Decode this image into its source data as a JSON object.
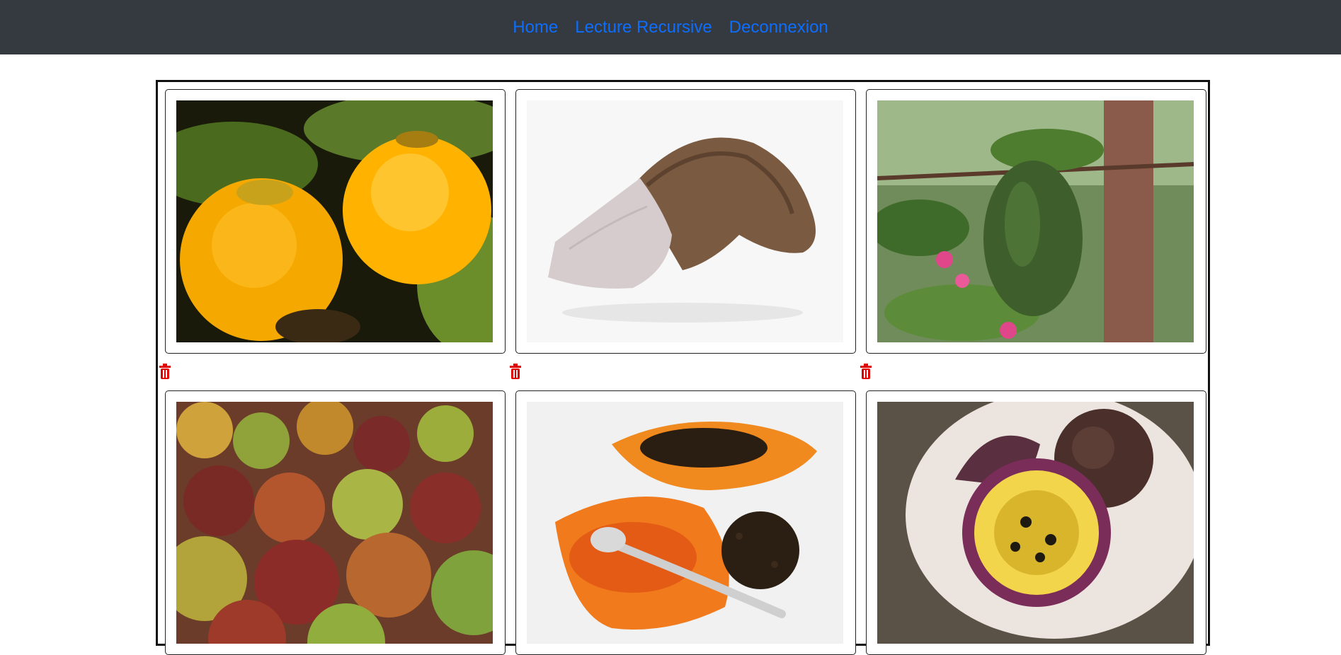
{
  "nav": {
    "links": [
      "Home",
      "Lecture Recursive",
      "Deconnexion"
    ]
  },
  "gallery": {
    "cards": [
      {
        "icon": "persimmon-photo"
      },
      {
        "icon": "taro-photo"
      },
      {
        "icon": "soursop-photo"
      },
      {
        "icon": "mango-photo"
      },
      {
        "icon": "papaya-photo"
      },
      {
        "icon": "passion-fruit-photo"
      }
    ],
    "delete_icon": "trash-icon",
    "delete_color": "#e00000"
  }
}
